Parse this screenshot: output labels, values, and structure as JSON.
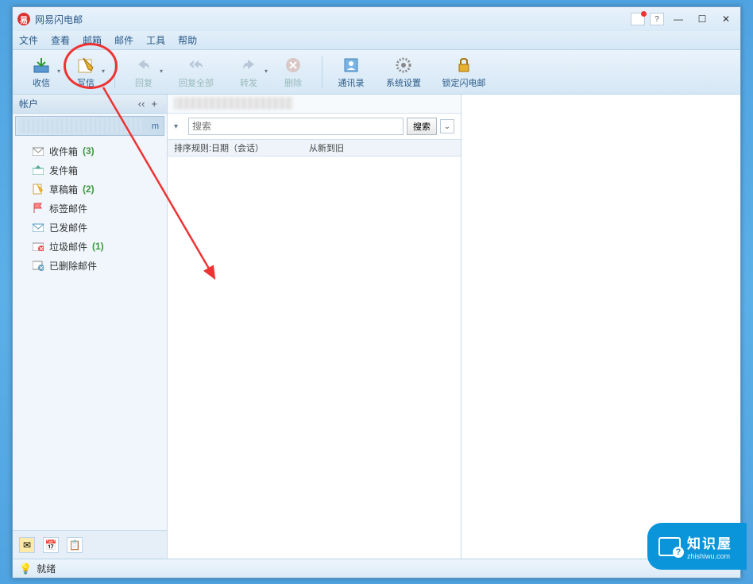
{
  "title": "网易闪电邮",
  "menus": [
    "文件",
    "查看",
    "邮箱",
    "邮件",
    "工具",
    "帮助"
  ],
  "toolbar": {
    "receive": "收信",
    "compose": "写信",
    "reply": "回复",
    "reply_all": "回复全部",
    "forward": "转发",
    "delete": "删除",
    "contacts": "通讯录",
    "settings": "系统设置",
    "lock": "锁定闪电邮"
  },
  "sidebar": {
    "tab": "帐户",
    "account_suffix": "m",
    "folders": [
      {
        "icon": "inbox",
        "label": "收件箱",
        "count": "(3)"
      },
      {
        "icon": "outbox",
        "label": "发件箱",
        "count": ""
      },
      {
        "icon": "draft",
        "label": "草稿箱",
        "count": "(2)"
      },
      {
        "icon": "tag",
        "label": "标签邮件",
        "count": ""
      },
      {
        "icon": "sent",
        "label": "已发邮件",
        "count": ""
      },
      {
        "icon": "spam",
        "label": "垃圾邮件",
        "count": "(1)"
      },
      {
        "icon": "trash",
        "label": "已删除邮件",
        "count": ""
      }
    ]
  },
  "search": {
    "placeholder": "搜索",
    "button": "搜索"
  },
  "sort": {
    "rule": "排序规则:日期（会话）",
    "order": "从新到旧"
  },
  "status": "就绪",
  "watermark": {
    "cn": "知识屋",
    "url": "zhishiwu.com"
  }
}
